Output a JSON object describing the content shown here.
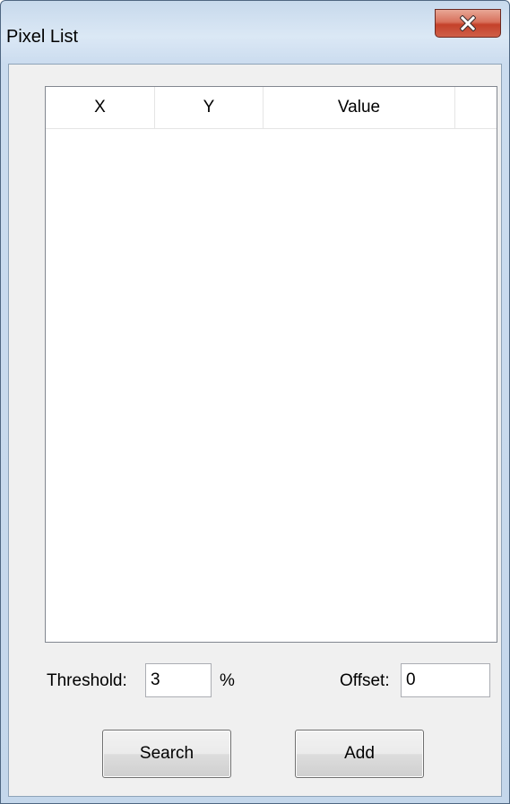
{
  "window": {
    "title": "Pixel List",
    "close_icon": "close-icon"
  },
  "list": {
    "columns": [
      "X",
      "Y",
      "Value"
    ],
    "rows": []
  },
  "threshold": {
    "label": "Threshold:",
    "value": "3",
    "unit": "%"
  },
  "offset": {
    "label": "Offset:",
    "value": "0"
  },
  "buttons": {
    "search": "Search",
    "add": "Add"
  }
}
